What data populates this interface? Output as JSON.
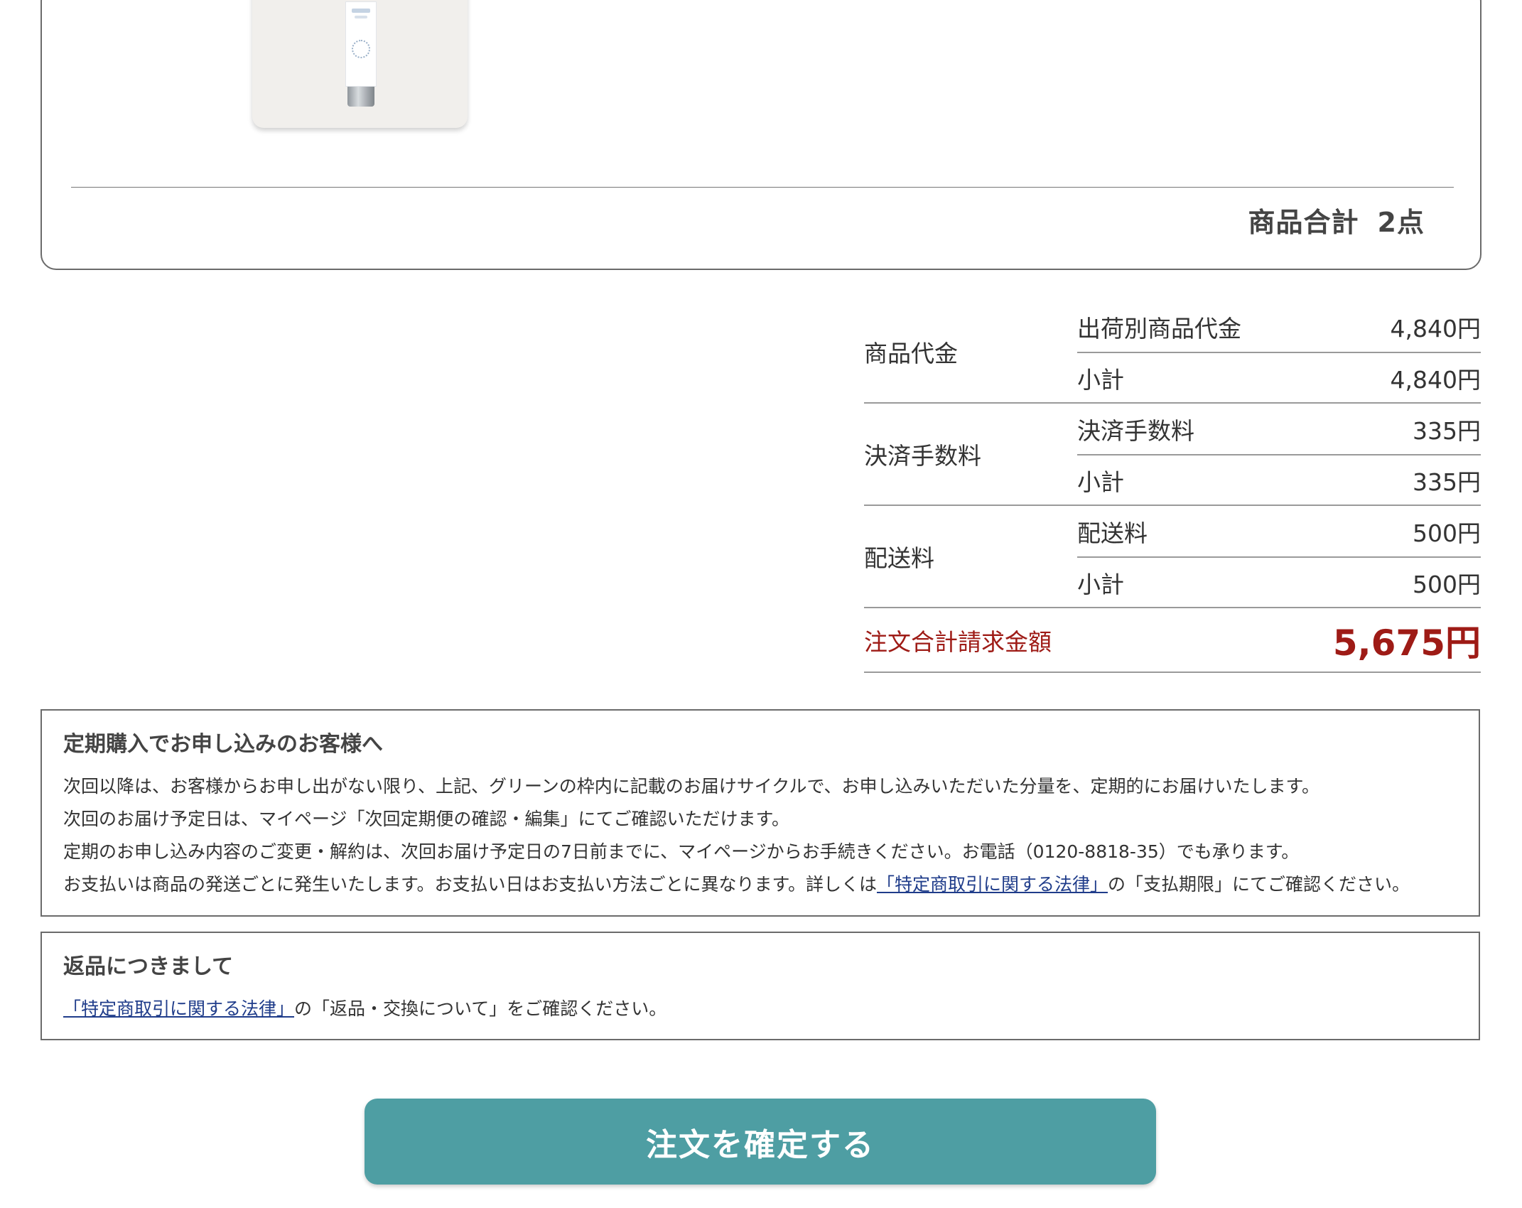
{
  "cart": {
    "total_label": "商品合計",
    "total_count": "2点"
  },
  "price_breakdown": {
    "groups": [
      {
        "label": "商品代金",
        "rows": [
          {
            "label": "出荷別商品代金",
            "amount": "4,840円"
          },
          {
            "label": "小計",
            "amount": "4,840円"
          }
        ]
      },
      {
        "label": "決済手数料",
        "rows": [
          {
            "label": "決済手数料",
            "amount": "335円"
          },
          {
            "label": "小計",
            "amount": "335円"
          }
        ]
      },
      {
        "label": "配送料",
        "rows": [
          {
            "label": "配送料",
            "amount": "500円"
          },
          {
            "label": "小計",
            "amount": "500円"
          }
        ]
      }
    ],
    "grand_total": {
      "label": "注文合計請求金額",
      "amount": "5,675円"
    }
  },
  "subscription_notice": {
    "title": "定期購入でお申し込みのお客様へ",
    "line1": "次回以降は、お客様からお申し出がない限り、上記、グリーンの枠内に記載のお届けサイクルで、お申し込みいただいた分量を、定期的にお届けいたします。",
    "line2": "次回のお届け予定日は、マイページ「次回定期便の確認・編集」にてご確認いただけます。",
    "line3": "定期のお申し込み内容のご変更・解約は、次回お届け予定日の7日前までに、マイページからお手続きください。お電話（0120-8818-35）でも承ります。",
    "line4_before": "お支払いは商品の発送ごとに発生いたします。お支払い日はお支払い方法ごとに異なります。詳しくは",
    "line4_link": "「特定商取引に関する法律」",
    "line4_after": "の「支払期限」にてご確認ください。"
  },
  "return_notice": {
    "title": "返品につきまして",
    "link": "「特定商取引に関する法律」",
    "text_after": "の「返品・交換について」をご確認ください。"
  },
  "confirm_button": {
    "label": "注文を確定する"
  },
  "colors": {
    "accent_button": "#4e9ea3",
    "grand_total": "#9e1b16",
    "link": "#1f3c8a"
  }
}
